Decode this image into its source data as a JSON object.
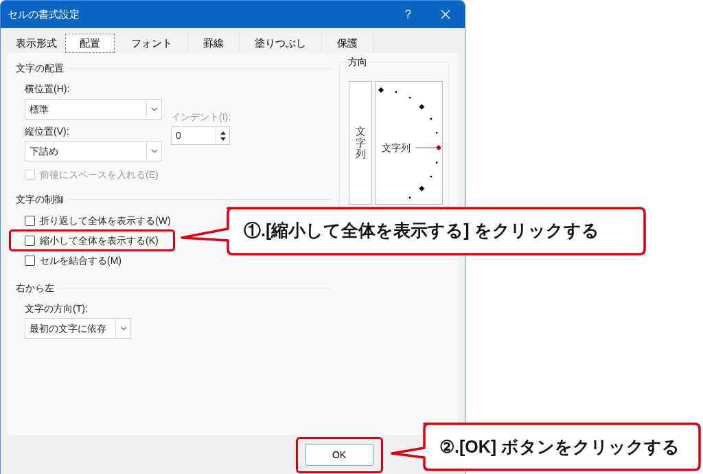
{
  "dialog": {
    "title": "セルの書式設定",
    "help": "?"
  },
  "tabs": [
    {
      "label": "表示形式",
      "selected": false
    },
    {
      "label": "配置",
      "selected": true
    },
    {
      "label": "フォント",
      "selected": false
    },
    {
      "label": "罫線",
      "selected": false
    },
    {
      "label": "塗りつぶし",
      "selected": false
    },
    {
      "label": "保護",
      "selected": false
    }
  ],
  "alignment": {
    "title": "文字の配置",
    "horizontal": {
      "label": "横位置(H):",
      "value": "標準"
    },
    "indent": {
      "label": "インデント(I):",
      "value": "0",
      "disabled": true
    },
    "vertical": {
      "label": "縦位置(V):",
      "value": "下詰め"
    },
    "distributed": {
      "label": "前後にスペースを入れる(E)",
      "checked": false,
      "disabled": true
    }
  },
  "text_control": {
    "title": "文字の制御",
    "options": [
      {
        "label": "折り返して全体を表示する(W)",
        "checked": false,
        "highlighted": false
      },
      {
        "label": "縮小して全体を表示する(K)",
        "checked": false,
        "highlighted": true
      },
      {
        "label": "セルを結合する(M)",
        "checked": false,
        "highlighted": false
      }
    ]
  },
  "right_to_left": {
    "title": "右から左",
    "direction": {
      "label": "文字の方向(T):",
      "value": "最初の文字に依存"
    }
  },
  "orientation": {
    "title": "方向",
    "vertical_text": "文字列",
    "dial_text": "文字列"
  },
  "buttons": [
    {
      "label": "OK",
      "highlighted": true
    }
  ],
  "callouts": [
    {
      "text": "①.[縮小して全体を表示する] をクリックする"
    },
    {
      "text": "②.[OK] ボタンをクリックする"
    }
  ]
}
